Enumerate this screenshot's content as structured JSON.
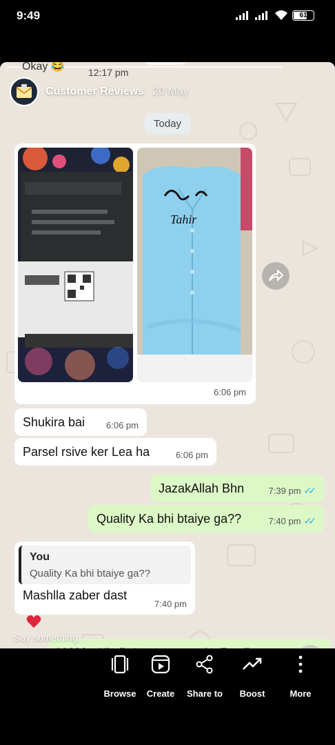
{
  "status_bar": {
    "time": "9:49",
    "battery": "61",
    "icons": [
      "signal-icon",
      "signal-icon",
      "wifi-icon",
      "battery-icon"
    ]
  },
  "story": {
    "peek": {
      "text": "Okay",
      "emoji": "😂",
      "time": "12:17 pm"
    },
    "header": {
      "username": "Customer Reviews",
      "date": "20 May",
      "avatar_icon": "envelope-icon"
    },
    "date_pill": "Today",
    "media": {
      "time": "6:06 pm",
      "photo_caption": "Tahir",
      "forward_icon": "forward-icon"
    },
    "messages": [
      {
        "direction": "in",
        "text": "Shukira bai",
        "time": "6:06 pm"
      },
      {
        "direction": "in",
        "text": "Parsel rsive ker Lea ha",
        "time": "6:06 pm"
      },
      {
        "direction": "out",
        "text": "JazakAllah Bhn",
        "time": "7:39 pm",
        "status": "read"
      },
      {
        "direction": "out",
        "text": "Quality Ka bhi btaiye ga??",
        "time": "7:40 pm",
        "status": "read"
      }
    ],
    "reply_message": {
      "quoted_author": "You",
      "quoted_text": "Quality Ka bhi btaiye ga??",
      "text": "Mashlla zaber dast",
      "time": "7:40 pm"
    },
    "reaction": "heart-icon",
    "reply_placeholder": "Say something...",
    "bottom_message": "Mri bhn Kindly Instagram pr Ap Feedbac"
  },
  "colors": {
    "chat_bg": "#ece5dd",
    "bubble_out": "#dcf8c6",
    "bubble_in": "#ffffff",
    "read_ticks": "#34b7f1"
  },
  "nav": {
    "items": [
      {
        "label": "Browse",
        "icon": "browse-icon"
      },
      {
        "label": "Create",
        "icon": "create-icon"
      },
      {
        "label": "Share to",
        "icon": "share-icon"
      },
      {
        "label": "Boost",
        "icon": "boost-icon"
      },
      {
        "label": "More",
        "icon": "more-icon"
      }
    ]
  }
}
